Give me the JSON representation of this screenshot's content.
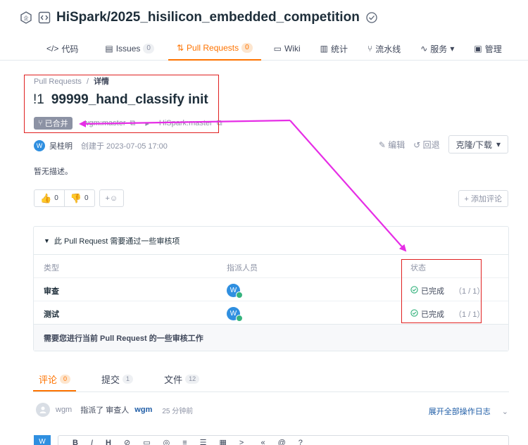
{
  "colors": {
    "accent": "#fe7300",
    "annotation_red": "#e02020",
    "annotation_magenta": "#e62ee6",
    "success": "#36b37e",
    "link": "#1e5ca6"
  },
  "header": {
    "repo_name": "HiSpark/2025_hisilicon_embedded_competition",
    "icons": [
      "enterprise-badge-icon",
      "code-repo-icon",
      "verified-icon"
    ],
    "tabs": [
      {
        "label": "代码",
        "icon": "code-icon"
      },
      {
        "label": "Issues",
        "count": "0",
        "icon": "issues-icon"
      },
      {
        "label": "Pull Requests",
        "count": "0",
        "icon": "pull-request-icon",
        "active": true
      },
      {
        "label": "Wiki",
        "icon": "wiki-icon"
      },
      {
        "label": "统计",
        "icon": "stats-icon"
      },
      {
        "label": "流水线",
        "icon": "pipeline-icon"
      },
      {
        "label": "服务",
        "icon": "pulse-icon"
      },
      {
        "label": "管理",
        "icon": "settings-icon"
      }
    ]
  },
  "pr": {
    "breadcrumb_root": "Pull Requests",
    "breadcrumb_sep": "/",
    "breadcrumb_current": "详情",
    "number": "!1",
    "title": "99999_hand_classify init",
    "status": "已合并",
    "source_branch": "wgm:master",
    "target_branch": "HiSpark:master",
    "author_avatar": "W",
    "author": "吴桂明",
    "created": "创建于 2023-07-05 17:00",
    "edit_label": "编辑",
    "revert_label": "回退",
    "clone_label": "克隆/下载",
    "description": "暂无描述。"
  },
  "reactions": {
    "thumbs_up": "0",
    "thumbs_down": "0",
    "add_emoji": "+☺",
    "add_comment": "+ 添加评论"
  },
  "review": {
    "heading": "此 Pull Request 需要通过一些审核项",
    "columns": [
      "类型",
      "指派人员",
      "状态"
    ],
    "rows": [
      {
        "type": "审查",
        "assignee": "W",
        "status": "已完成",
        "ratio": "（1 / 1）"
      },
      {
        "type": "测试",
        "assignee": "W",
        "status": "已完成",
        "ratio": "（1 / 1）"
      }
    ],
    "footer": "需要您进行当前 Pull Request 的一些审核工作"
  },
  "content_tabs": [
    {
      "label": "评论",
      "count": "0",
      "active": true
    },
    {
      "label": "提交",
      "count": "1"
    },
    {
      "label": "文件",
      "count": "12"
    }
  ],
  "timeline": {
    "user": "wgm",
    "action": "指派了 审查人",
    "target": "wgm",
    "time": "25 分钟前",
    "expand_label": "展开全部操作日志"
  },
  "editor": {
    "avatar": "W",
    "toolbar": [
      "B",
      "I",
      "H",
      "link-icon",
      "image-icon",
      "mention-icon",
      "list-icon",
      "ordered-list-icon",
      "table-icon",
      "code-icon",
      "quote-icon",
      "at-icon",
      "help-icon"
    ]
  }
}
